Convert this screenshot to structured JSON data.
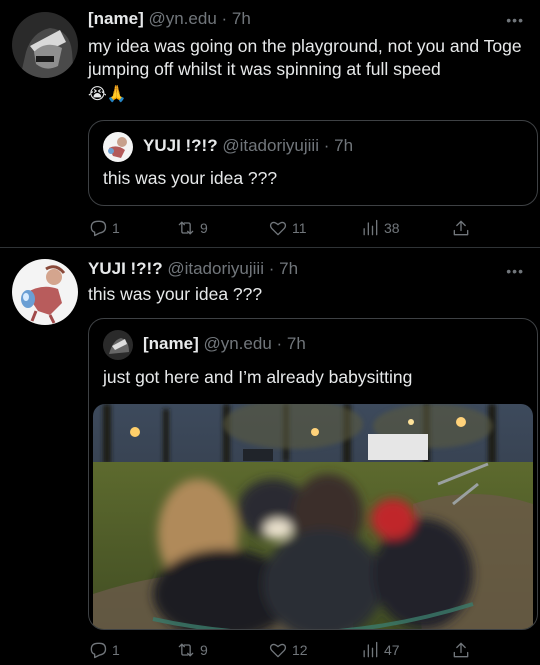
{
  "tweet1": {
    "name": "[name]",
    "handle": "@yn.edu",
    "time": "7h",
    "text": "my idea was going on the playground, not you and Toge jumping off whilst it was spinning at full speed",
    "emojis": "😭🙏",
    "quote": {
      "name": "YUJI !?!?",
      "handle": "@itadoriyujiii",
      "time": "7h",
      "text": "this was your idea ???"
    },
    "actions": {
      "reply": "1",
      "retweet": "9",
      "like": "11",
      "views": "38"
    }
  },
  "tweet2": {
    "name": "YUJI !?!?",
    "handle": "@itadoriyujiii",
    "time": "7h",
    "text": "this was your idea ???",
    "quote": {
      "name": "[name]",
      "handle": "@yn.edu",
      "time": "7h",
      "text": "just got here and I’m already babysitting"
    },
    "actions": {
      "reply": "1",
      "retweet": "9",
      "like": "12",
      "views": "47"
    }
  },
  "ui": {
    "sep": "·",
    "more": "•••"
  }
}
